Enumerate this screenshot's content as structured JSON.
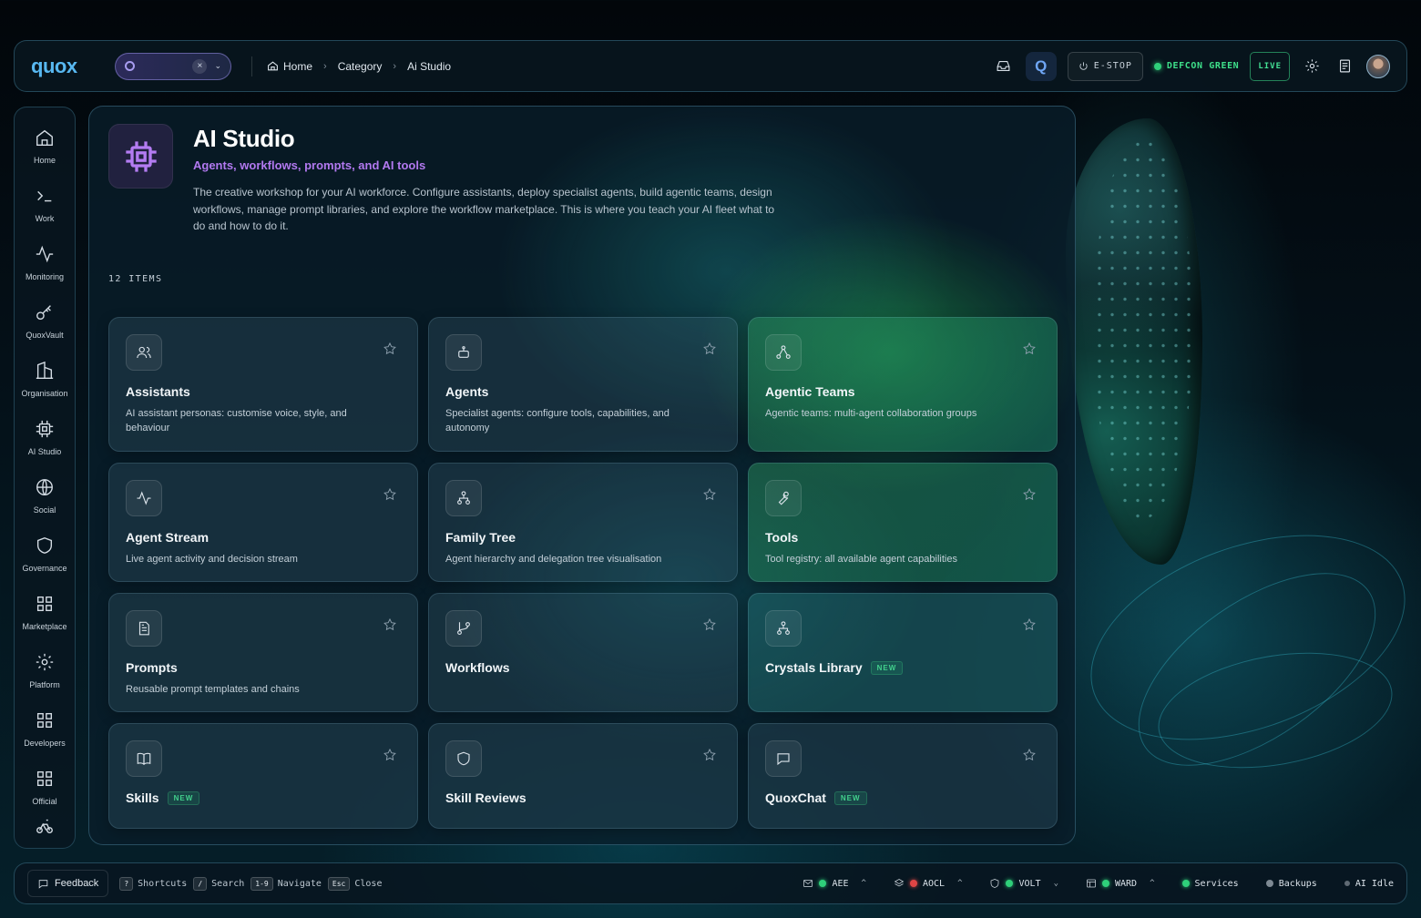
{
  "app": {
    "logo": "quox"
  },
  "breadcrumb": {
    "home": "Home",
    "category": "Category",
    "current": "Ai Studio"
  },
  "topbar": {
    "estop_label": "E-STOP",
    "defcon_label": "DEFCON GREEN",
    "live_label": "LIVE",
    "q_label": "Q",
    "search_clear": "×",
    "search_caret": "⌄"
  },
  "sidebar": {
    "items": [
      {
        "label": "Home",
        "icon": "home-icon"
      },
      {
        "label": "Work",
        "icon": "terminal-icon"
      },
      {
        "label": "Monitoring",
        "icon": "activity-icon"
      },
      {
        "label": "QuoxVault",
        "icon": "key-icon"
      },
      {
        "label": "Organisation",
        "icon": "building-icon"
      },
      {
        "label": "AI Studio",
        "icon": "chip-icon"
      },
      {
        "label": "Social",
        "icon": "globe-icon"
      },
      {
        "label": "Governance",
        "icon": "shield-icon"
      },
      {
        "label": "Marketplace",
        "icon": "grid-icon"
      },
      {
        "label": "Platform",
        "icon": "gear-icon"
      },
      {
        "label": "Developers",
        "icon": "grid-icon"
      },
      {
        "label": "Official",
        "icon": "grid-icon"
      }
    ]
  },
  "page": {
    "title": "AI Studio",
    "subtitle": "Agents, workflows, prompts, and AI tools",
    "description": "The creative workshop for your AI workforce. Configure assistants, deploy specialist agents, build agentic teams, design workflows, manage prompt libraries, and explore the workflow marketplace. This is where you teach your AI fleet what to do and how to do it.",
    "items_count": "12 ITEMS"
  },
  "cards": [
    {
      "title": "Assistants",
      "desc": "AI assistant personas: customise voice, style, and behaviour",
      "icon": "users-icon",
      "badge": ""
    },
    {
      "title": "Agents",
      "desc": "Specialist agents: configure tools, capabilities, and autonomy",
      "icon": "robot-icon",
      "badge": ""
    },
    {
      "title": "Agentic Teams",
      "desc": "Agentic teams: multi-agent collaboration groups",
      "icon": "network-icon",
      "badge": ""
    },
    {
      "title": "Agent Stream",
      "desc": "Live agent activity and decision stream",
      "icon": "activity-icon",
      "badge": ""
    },
    {
      "title": "Family Tree",
      "desc": "Agent hierarchy and delegation tree visualisation",
      "icon": "hierarchy-icon",
      "badge": ""
    },
    {
      "title": "Tools",
      "desc": "Tool registry: all available agent capabilities",
      "icon": "wrench-icon",
      "badge": ""
    },
    {
      "title": "Prompts",
      "desc": "Reusable prompt templates and chains",
      "icon": "document-icon",
      "badge": ""
    },
    {
      "title": "Workflows",
      "desc": "",
      "icon": "branch-icon",
      "badge": ""
    },
    {
      "title": "Crystals Library",
      "desc": "",
      "icon": "hierarchy-icon",
      "badge": "NEW"
    },
    {
      "title": "Skills",
      "desc": "",
      "icon": "book-icon",
      "badge": "NEW"
    },
    {
      "title": "Skill Reviews",
      "desc": "",
      "icon": "shield-icon",
      "badge": ""
    },
    {
      "title": "QuoxChat",
      "desc": "",
      "icon": "chat-icon",
      "badge": "NEW"
    }
  ],
  "bottombar": {
    "feedback": "Feedback",
    "shortcuts": [
      {
        "key": "?",
        "label": "Shortcuts"
      },
      {
        "key": "/",
        "label": "Search"
      },
      {
        "key": "1-9",
        "label": "Navigate"
      },
      {
        "key": "Esc",
        "label": "Close"
      }
    ],
    "services": [
      {
        "name": "AEE",
        "status": "green",
        "caret": "^"
      },
      {
        "name": "AOCL",
        "status": "red",
        "caret": "^"
      },
      {
        "name": "VOLT",
        "status": "green",
        "caret": "⌄"
      },
      {
        "name": "WARD",
        "status": "green",
        "caret": "^"
      }
    ],
    "services_label": "Services",
    "backups_label": "Backups",
    "ai_label": "AI Idle"
  },
  "colors": {
    "accent_purple": "#b279f0",
    "status_green": "#2fd07a",
    "status_red": "#e04545",
    "logo_blue": "#58b8f0"
  }
}
